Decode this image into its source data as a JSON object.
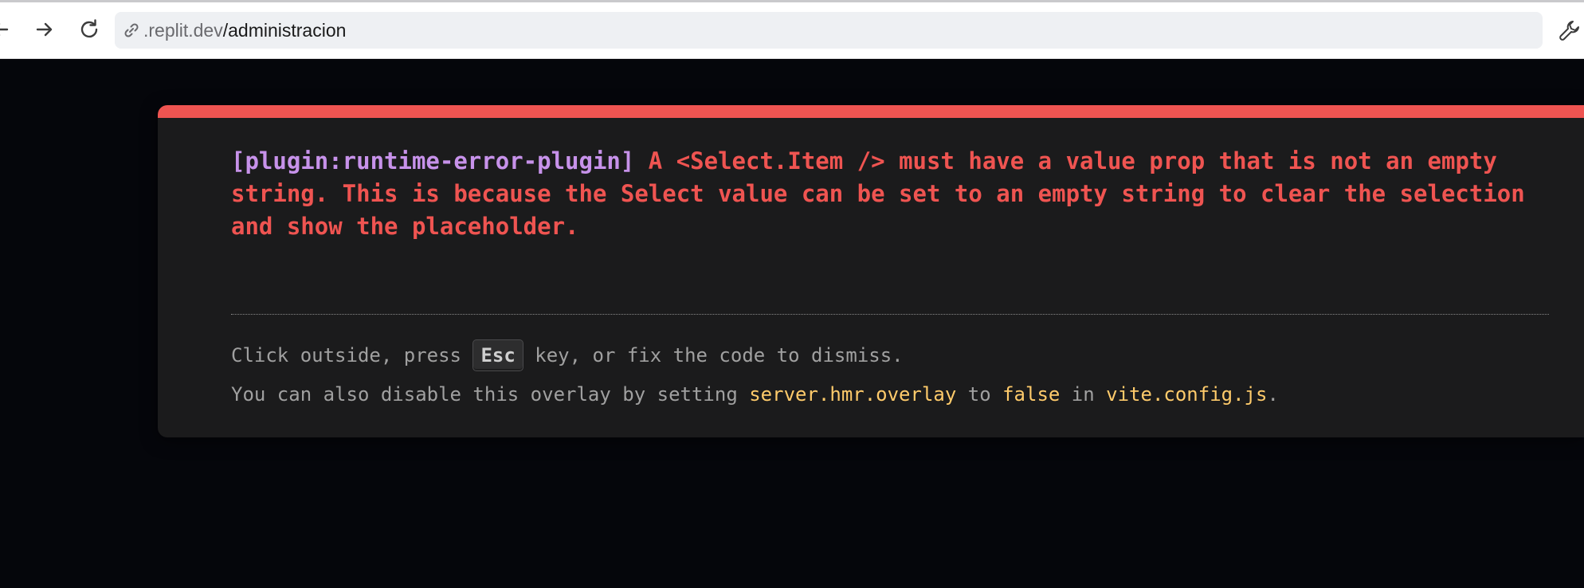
{
  "browser": {
    "url_domain": ".replit.dev",
    "url_path": "/administracion"
  },
  "overlay": {
    "plugin": "[plugin:runtime-error-plugin]",
    "message": "A <Select.Item /> must have a value prop that is not an empty string. This is because the Select value can be set to an empty string to clear the selection and show the placeholder.",
    "tip1_before": "Click outside, press ",
    "tip1_key": "Esc",
    "tip1_after": " key, or fix the code to dismiss.",
    "tip2_a": "You can also disable this overlay by setting ",
    "tip2_code1": "server.hmr.overlay",
    "tip2_b": " to ",
    "tip2_code2": "false",
    "tip2_c": " in ",
    "tip2_code3": "vite.config.js",
    "tip2_d": ".",
    "colors": {
      "accent": "#ef5451",
      "plugin": "#c792ea",
      "code": "#ffcb6b",
      "background": "#1b1b1c"
    }
  },
  "icons": [
    "back-icon",
    "forward-icon",
    "reload-icon",
    "link-icon",
    "wrench-icon"
  ]
}
